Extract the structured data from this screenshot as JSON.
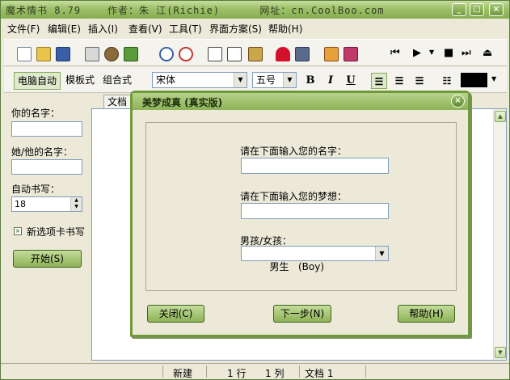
{
  "window": {
    "title": "魔术情书 8.79    作者：朱 江(Richie)      网址：cn.CoolBoo.com"
  },
  "menu": [
    {
      "label": "文件(F)"
    },
    {
      "label": "编辑(E)"
    },
    {
      "label": "插入(I)"
    },
    {
      "label": "查看(V)"
    },
    {
      "label": "工具(T)"
    },
    {
      "label": "界面方案(S)"
    },
    {
      "label": "帮助(H)"
    }
  ],
  "toolbar2": {
    "modes": [
      "电脑自动",
      "模板式",
      "组合式"
    ],
    "font": "宋体",
    "size": "五号",
    "bold": "B",
    "italic": "I",
    "underline": "U"
  },
  "sidepanel": {
    "your_name_label": "你的名字：",
    "other_name_label": "她/他的名字：",
    "auto_write_label": "自动书写：",
    "auto_write_value": "18",
    "new_tab_label": "新选项卡书写",
    "start_button": "开始(S)"
  },
  "editor": {
    "tab_label": "文档"
  },
  "status": {
    "mode": "新建",
    "line": "1 行",
    "col": "1 列",
    "doc": "文档 1"
  },
  "dialog": {
    "title": "美梦成真 (真实版)",
    "name_label": "请在下面输入您的名字：",
    "dream_label": "请在下面输入您的梦想：",
    "gender_label": "男孩/女孩：",
    "gender_value": "男生   (Boy)",
    "close_button": "关闭(C)",
    "next_button": "下一步(N)",
    "help_button": "帮助(H)"
  },
  "colors": {
    "accent": "#8db256",
    "titlebar": "#9cc068"
  }
}
